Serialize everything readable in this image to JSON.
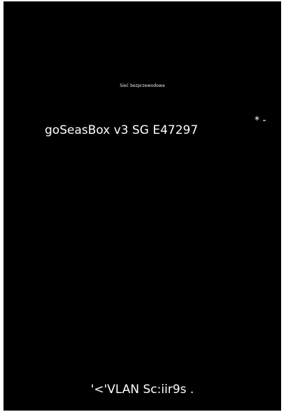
{
  "screen": {
    "background": "#000000",
    "header_title": "Sieć bezprzewodowa",
    "network": {
      "name": "goSeasBox v3 SG E47297",
      "mark": "* -"
    },
    "footer_text": "'<'VLAN Sc:iir9s ."
  }
}
